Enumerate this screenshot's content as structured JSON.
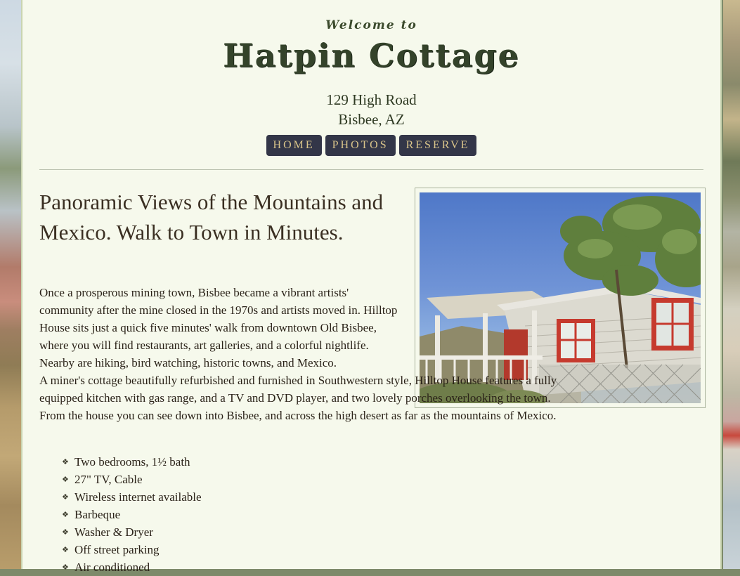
{
  "header": {
    "welcome": "Welcome to",
    "title": "Hatpin Cottage",
    "address_line1": "129 High Road",
    "address_line2": "Bisbee, AZ"
  },
  "nav": {
    "home": "HOME",
    "photos": "PHOTOS",
    "reserve": "RESERVE",
    "button_color": "#333648",
    "button_text_color": "#d9c48a"
  },
  "main": {
    "headline": "Panoramic Views of the Mountains and Mexico. Walk to Town in Minutes.",
    "paragraph1": "Once a prosperous mining town, Bisbee became a vibrant artists' community after the mine closed in the 1970s and artists moved in. Hilltop House sits just a quick five minutes' walk from downtown Old Bisbee, where you will find restaurants, art galleries, and a colorful nightlife. Nearby are hiking, bird watching, historic towns, and Mexico.",
    "paragraph2": "A miner's cottage beautifully refurbished and furnished in Southwestern style, Hilltop House features a fully equipped kitchen with gas range, and a TV and DVD player, and two lovely porches overlooking the town. From the house you can see down into Bisbee, and across the high desert as far as the mountains of Mexico.",
    "photo_icon": "cottage-photo",
    "features": [
      "Two bedrooms, 1½ bath",
      "27\" TV, Cable",
      "Wireless internet available",
      "Barbeque",
      "Washer & Dryer",
      "Off street parking",
      "Air conditioned"
    ]
  },
  "colors": {
    "page_bg": "#f6f9ec",
    "title": "#34432a",
    "text": "#2a2218"
  }
}
